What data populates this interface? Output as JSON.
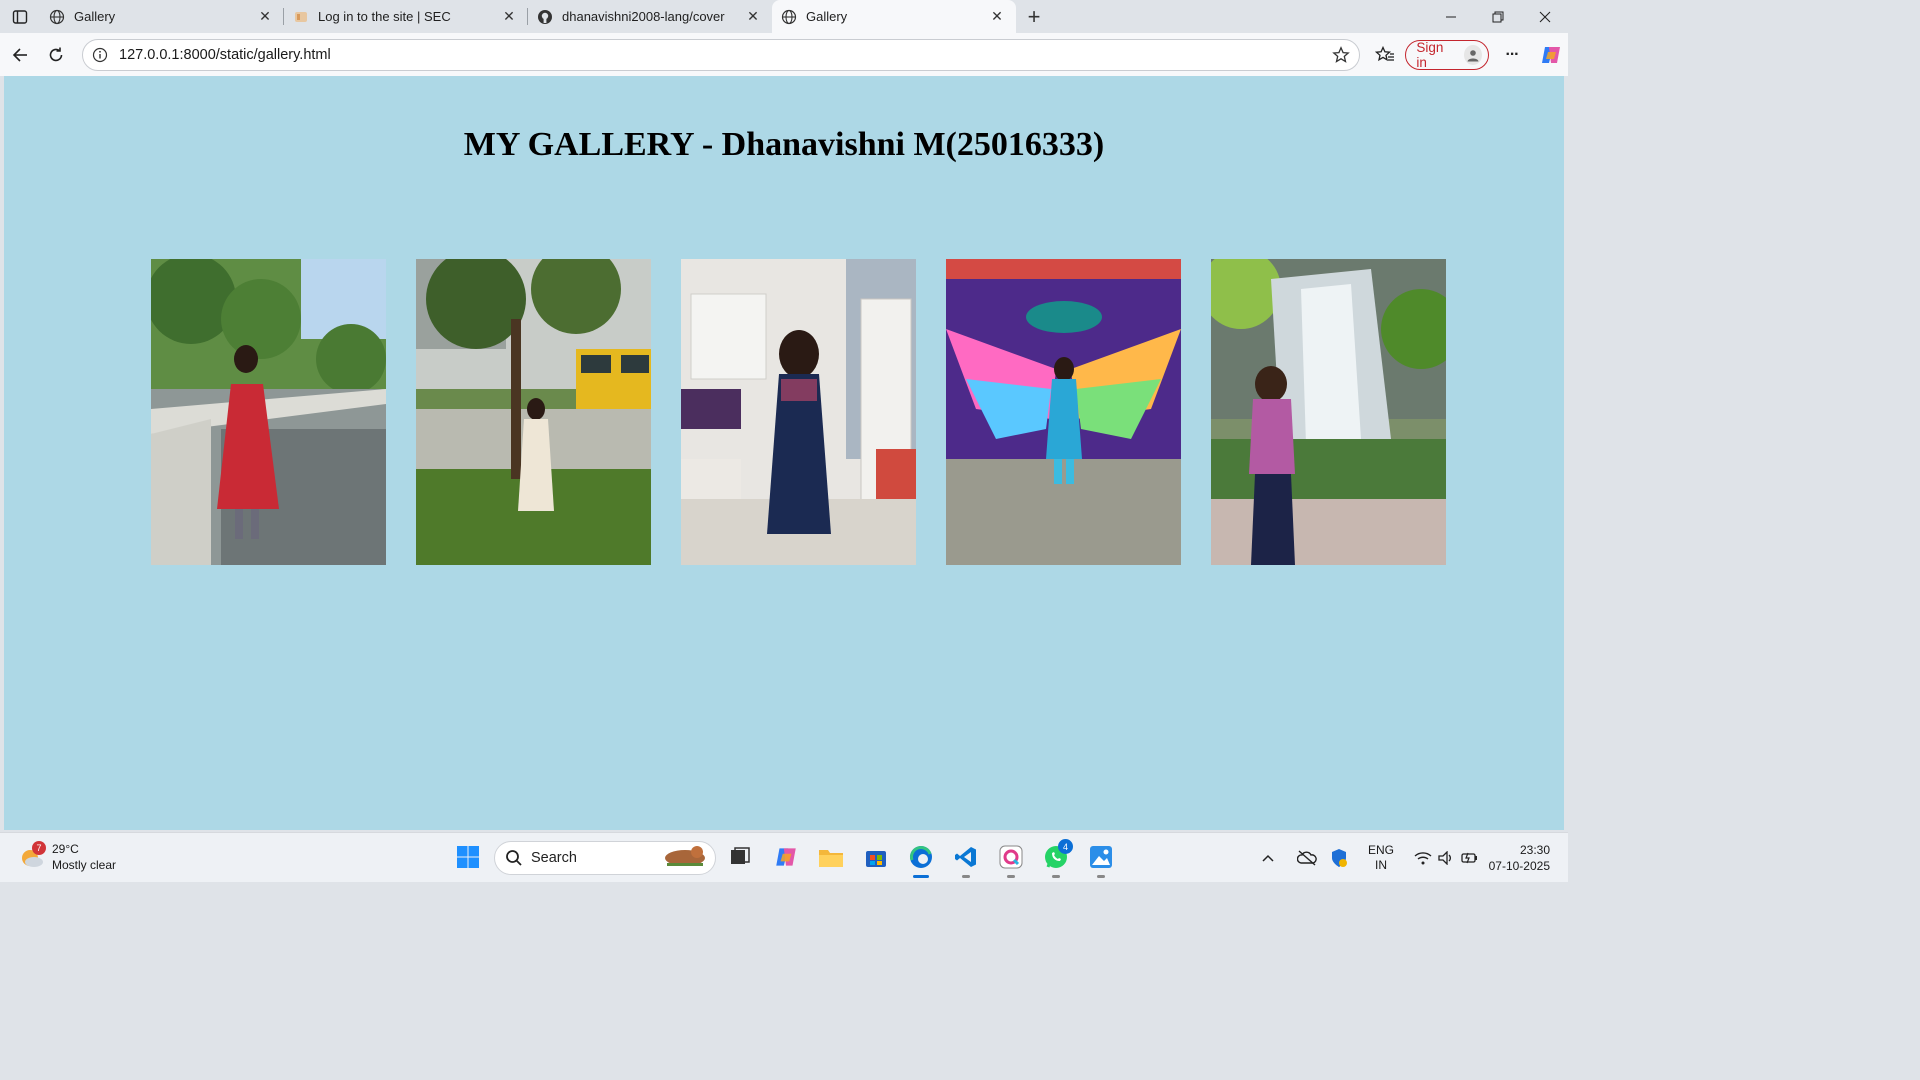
{
  "browser": {
    "tabs": [
      {
        "title": "Gallery",
        "icon": "globe-icon",
        "active": false
      },
      {
        "title": "Log in to the site | SEC",
        "icon": "site-favicon",
        "active": false
      },
      {
        "title": "dhanavishni2008-lang/cover",
        "icon": "github-icon",
        "active": false
      },
      {
        "title": "Gallery",
        "icon": "globe-icon",
        "active": true
      }
    ],
    "close_glyph": "✕",
    "new_tab_glyph": "+",
    "url": "127.0.0.1:8000/static/gallery.html",
    "sign_in_label": "Sign in",
    "more_glyph": "···"
  },
  "page": {
    "background": "#add8e6",
    "title": "MY GALLERY - Dhanavishni M(25016333)",
    "photos": [
      {
        "name": "photo-1",
        "scene": "red dress on a balcony with trees"
      },
      {
        "name": "photo-2",
        "scene": "white dress under a tree near yellow buses"
      },
      {
        "name": "photo-3",
        "scene": "navy kurta in a hostel room"
      },
      {
        "name": "photo-4",
        "scene": "blue dress in front of colorful wings mural"
      },
      {
        "name": "photo-5",
        "scene": "floral top in front of a waterfall"
      }
    ]
  },
  "taskbar": {
    "weather_temp": "29°C",
    "weather_desc": "Mostly clear",
    "weather_badge": "7",
    "search_placeholder": "Search",
    "whatsapp_badge": "4",
    "lang_top": "ENG",
    "lang_bottom": "IN",
    "time": "23:30",
    "date": "07-10-2025"
  },
  "colors": {
    "accent_red": "#c4262e",
    "edge_blue": "#0b6fd6",
    "vscode_blue": "#0a78d4",
    "whatsapp_green": "#25d366"
  }
}
